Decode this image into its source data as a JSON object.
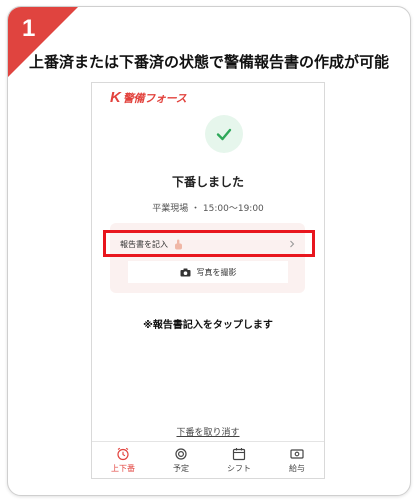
{
  "step": {
    "number": "1"
  },
  "heading": "上番済または下番済の状態で警備報告書の作成が可能",
  "app": {
    "brand_letter": "K",
    "brand_name": "警備フォース",
    "status_title": "下番しました",
    "site_info": "平業現場 ・ 15:00〜19:00",
    "report_label": "報告書を記入",
    "photo_label": "写真を撮影",
    "cancel_label": "下番を取り消す"
  },
  "note": "※報告書記入をタップします",
  "tabs": [
    {
      "label": "上下番",
      "icon": "alarm-clock-icon",
      "active": true
    },
    {
      "label": "予定",
      "icon": "ring-icon",
      "active": false
    },
    {
      "label": "シフト",
      "icon": "calendar-icon",
      "active": false
    },
    {
      "label": "給与",
      "icon": "money-icon",
      "active": false
    }
  ],
  "colors": {
    "accent": "#e2423d",
    "highlight": "#e8161e",
    "check": "#2fa85a",
    "report_bg": "#fbf1f0"
  }
}
